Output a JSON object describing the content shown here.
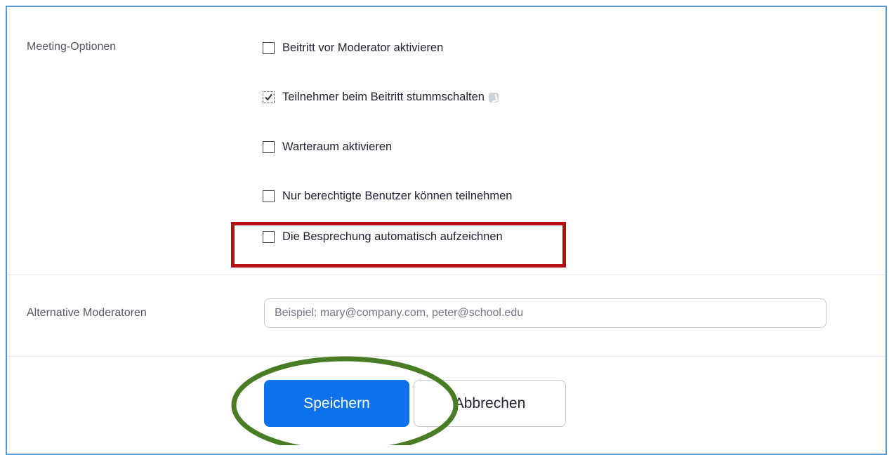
{
  "meeting_options": {
    "label": "Meeting-Optionen",
    "options": [
      {
        "label": "Beitritt vor Moderator aktivieren",
        "checked": false
      },
      {
        "label": "Teilnehmer beim Beitritt stummschalten",
        "checked": true,
        "icon": "info-icon"
      },
      {
        "label": "Warteraum aktivieren",
        "checked": false
      },
      {
        "label": "Nur berechtigte Benutzer können teilnehmen",
        "checked": false
      },
      {
        "label": "Die Besprechung automatisch aufzeichnen",
        "checked": false
      }
    ]
  },
  "alternative_hosts": {
    "label": "Alternative Moderatoren",
    "placeholder": "Beispiel: mary@company.com, peter@school.edu",
    "value": ""
  },
  "actions": {
    "save_label": "Speichern",
    "cancel_label": "Abbrechen"
  },
  "colors": {
    "primary": "#0e72ed",
    "highlight_red": "#b40f14",
    "highlight_green": "#4a7c26",
    "frame_border": "#5b9bd5"
  }
}
